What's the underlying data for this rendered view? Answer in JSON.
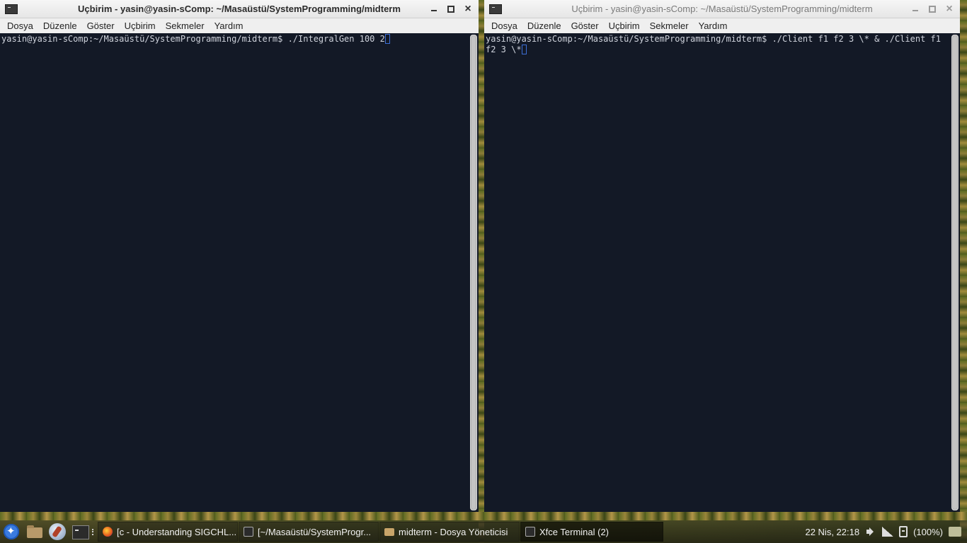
{
  "windows": {
    "left": {
      "title": "Uçbirim - yasin@yasin-sComp: ~/Masaüstü/SystemProgramming/midterm",
      "menu": [
        "Dosya",
        "Düzenle",
        "Göster",
        "Uçbirim",
        "Sekmeler",
        "Yardım"
      ],
      "terminal_text": "yasin@yasin-sComp:~/Masaüstü/SystemProgramming/midterm$ ./IntegralGen 100 2"
    },
    "right": {
      "title": "Uçbirim - yasin@yasin-sComp: ~/Masaüstü/SystemProgramming/midterm",
      "menu": [
        "Dosya",
        "Düzenle",
        "Göster",
        "Uçbirim",
        "Sekmeler",
        "Yardım"
      ],
      "terminal_text": "yasin@yasin-sComp:~/Masaüstü/SystemProgramming/midterm$ ./Client f1 f2 3 \\* & ./Client f1 f2 3 \\*"
    }
  },
  "window_controls": {
    "minimize": "minimize-icon",
    "maximize": "maximize-icon",
    "close": "×"
  },
  "taskbar": {
    "launchers": [
      "menu-icon",
      "file-manager-icon",
      "web-browser-icon",
      "terminal-icon"
    ],
    "tasks": [
      {
        "label": "[c - Understanding SIGCHL...",
        "icon": "firefox-icon"
      },
      {
        "label": "[~/Masaüstü/SystemProgr...",
        "icon": "terminal-icon"
      },
      {
        "label": "midterm - Dosya Yöneticisi",
        "icon": "folder-icon"
      },
      {
        "label": "Xfce Terminal (2)",
        "icon": "terminal-icon"
      }
    ],
    "clock": "22 Nis, 22:18",
    "battery": "(100%)"
  },
  "colors": {
    "terminal_bg": "#131926",
    "terminal_fg": "#cfd3dc",
    "cursor": "#3d6fd6"
  }
}
